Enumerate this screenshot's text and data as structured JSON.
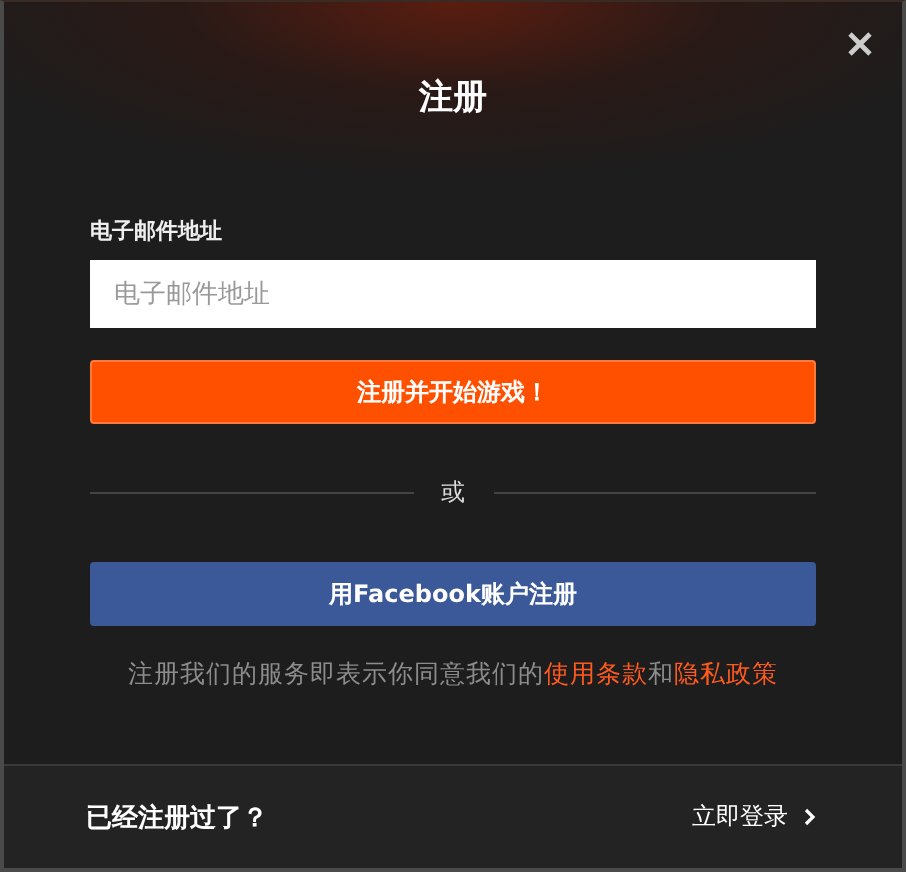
{
  "dialog": {
    "title": "注册"
  },
  "email": {
    "label": "电子邮件地址",
    "placeholder": "电子邮件地址"
  },
  "submit_button": "注册并开始游戏！",
  "divider_text": "或",
  "facebook_button": "用Facebook账户注册",
  "terms": {
    "text": "注册我们的服务即表示你同意我们的",
    "link_1": "使用条款",
    "joiner": "和",
    "link_2": "隐私政策"
  },
  "footer": {
    "question": "已经注册过了？",
    "login_link": "立即登录"
  }
}
